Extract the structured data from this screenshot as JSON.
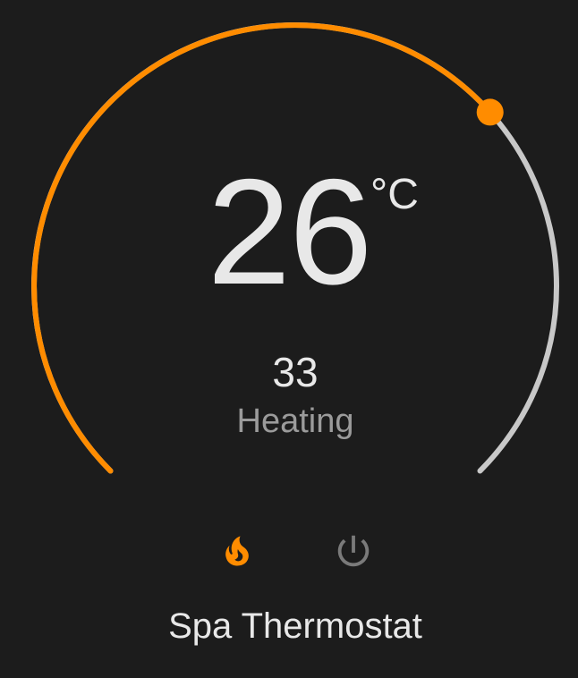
{
  "thermostat": {
    "name": "Spa Thermostat",
    "target_temperature": "26",
    "target_value": 26,
    "unit": "°C",
    "current_temperature": "33",
    "state": "Heating",
    "active_color": "#ff8c00",
    "track_color": "#c8c8c8",
    "modes": [
      {
        "name": "heat",
        "icon": "fire-icon",
        "active": true,
        "color": "#ff8c00"
      },
      {
        "name": "off",
        "icon": "power-icon",
        "active": false,
        "color": "#7a7a7a"
      }
    ]
  }
}
